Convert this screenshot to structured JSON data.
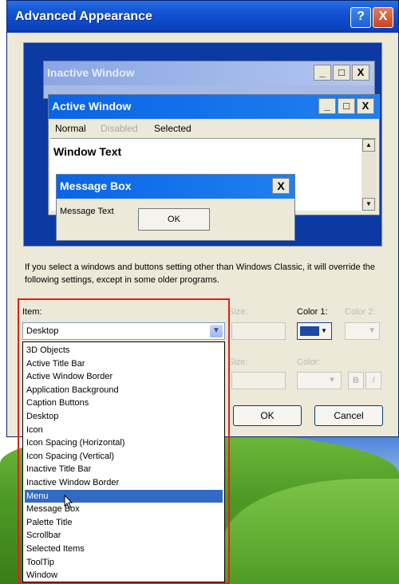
{
  "window": {
    "title": "Advanced Appearance",
    "help_glyph": "?",
    "close_glyph": "X"
  },
  "preview": {
    "inactive_title": "Inactive Window",
    "active_title": "Active Window",
    "menu_normal": "Normal",
    "menu_disabled": "Disabled",
    "menu_selected": "Selected",
    "window_text": "Window Text",
    "message_box_title": "Message Box",
    "message_text": "Message Text",
    "ok_label": "OK",
    "min_glyph": "_",
    "max_glyph": "□",
    "close_glyph": "X"
  },
  "info_text": "If you select a windows and buttons setting other than Windows Classic, it will override the following settings, except in some older programs.",
  "item": {
    "label": "Item:",
    "selected_value": "Desktop",
    "size_label": "Size:",
    "color1_label": "Color 1:",
    "color2_label": "Color 2:",
    "font_size_label": "Size:",
    "font_color_label": "Color:",
    "bold_label": "B",
    "italic_label": "I",
    "color1_value": "#1a4aa6",
    "options": [
      "3D Objects",
      "Active Title Bar",
      "Active Window Border",
      "Application Background",
      "Caption Buttons",
      "Desktop",
      "Icon",
      "Icon Spacing (Horizontal)",
      "Icon Spacing (Vertical)",
      "Inactive Title Bar",
      "Inactive Window Border",
      "Menu",
      "Message Box",
      "Palette Title",
      "Scrollbar",
      "Selected Items",
      "ToolTip",
      "Window"
    ],
    "highlighted_index": 11
  },
  "buttons": {
    "ok": "OK",
    "cancel": "Cancel"
  },
  "colors": {
    "titlebar": "#0b44c0",
    "preview_bg": "#0b3aa3",
    "selection": "#316ac5",
    "highlight_frame": "#e0201a"
  }
}
